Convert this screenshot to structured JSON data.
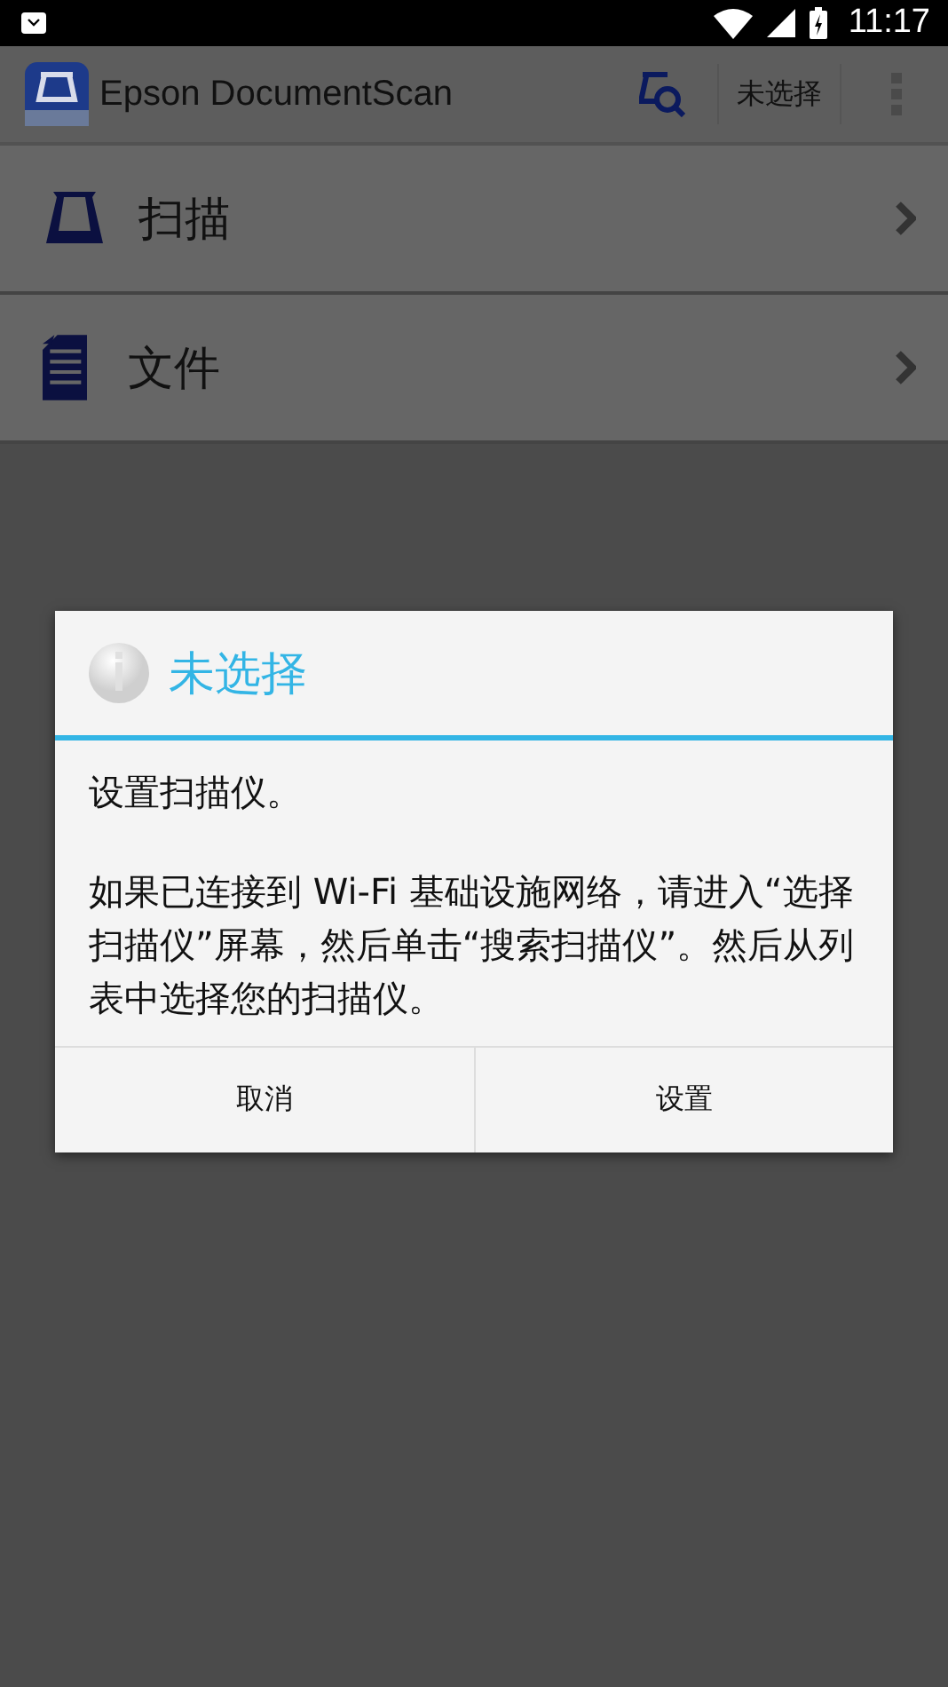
{
  "status_bar": {
    "time": "11:17"
  },
  "app_bar": {
    "title": "Epson DocumentScan",
    "scanner_button": "未选择"
  },
  "menu": [
    {
      "kind": "scan",
      "label": "扫描"
    },
    {
      "kind": "documents",
      "label": "文件"
    }
  ],
  "dialog": {
    "title": "未选择",
    "message": [
      "设置扫描仪。",
      "如果已连接到 Wi-Fi 基础设施网络，请进入“选择扫描仪”屏幕，然后单击“搜索扫描仪”。然后从列表中选择您的扫描仪。"
    ],
    "buttons": [
      "取消",
      "设置"
    ]
  }
}
